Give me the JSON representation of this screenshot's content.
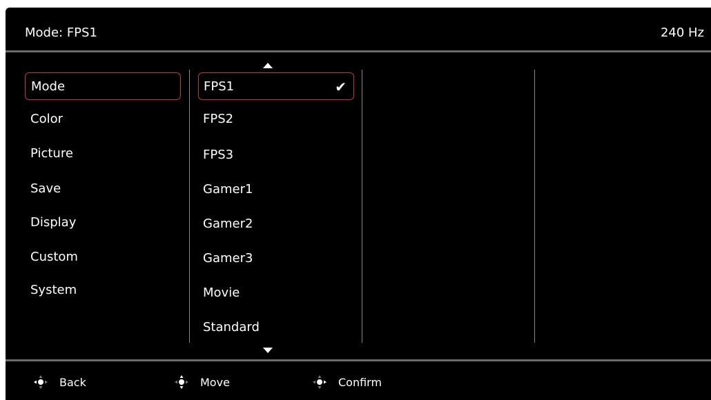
{
  "header": {
    "title": "Mode: FPS1",
    "refresh_rate": "240 Hz"
  },
  "menu": {
    "items": [
      {
        "label": "Mode"
      },
      {
        "label": "Color"
      },
      {
        "label": "Picture"
      },
      {
        "label": "Save"
      },
      {
        "label": "Display"
      },
      {
        "label": "Custom"
      },
      {
        "label": "System"
      }
    ],
    "selected": "Mode"
  },
  "options": {
    "items": [
      {
        "label": "FPS1"
      },
      {
        "label": "FPS2"
      },
      {
        "label": "FPS3"
      },
      {
        "label": "Gamer1"
      },
      {
        "label": "Gamer2"
      },
      {
        "label": "Gamer3"
      },
      {
        "label": "Movie"
      },
      {
        "label": "Standard"
      }
    ],
    "selected": "FPS1",
    "selected_mark": "✔"
  },
  "footer": {
    "back": "Back",
    "move": "Move",
    "confirm": "Confirm"
  },
  "colors": {
    "accent": "#c2334f",
    "background": "#000000",
    "rule": "#6b6b6b"
  }
}
